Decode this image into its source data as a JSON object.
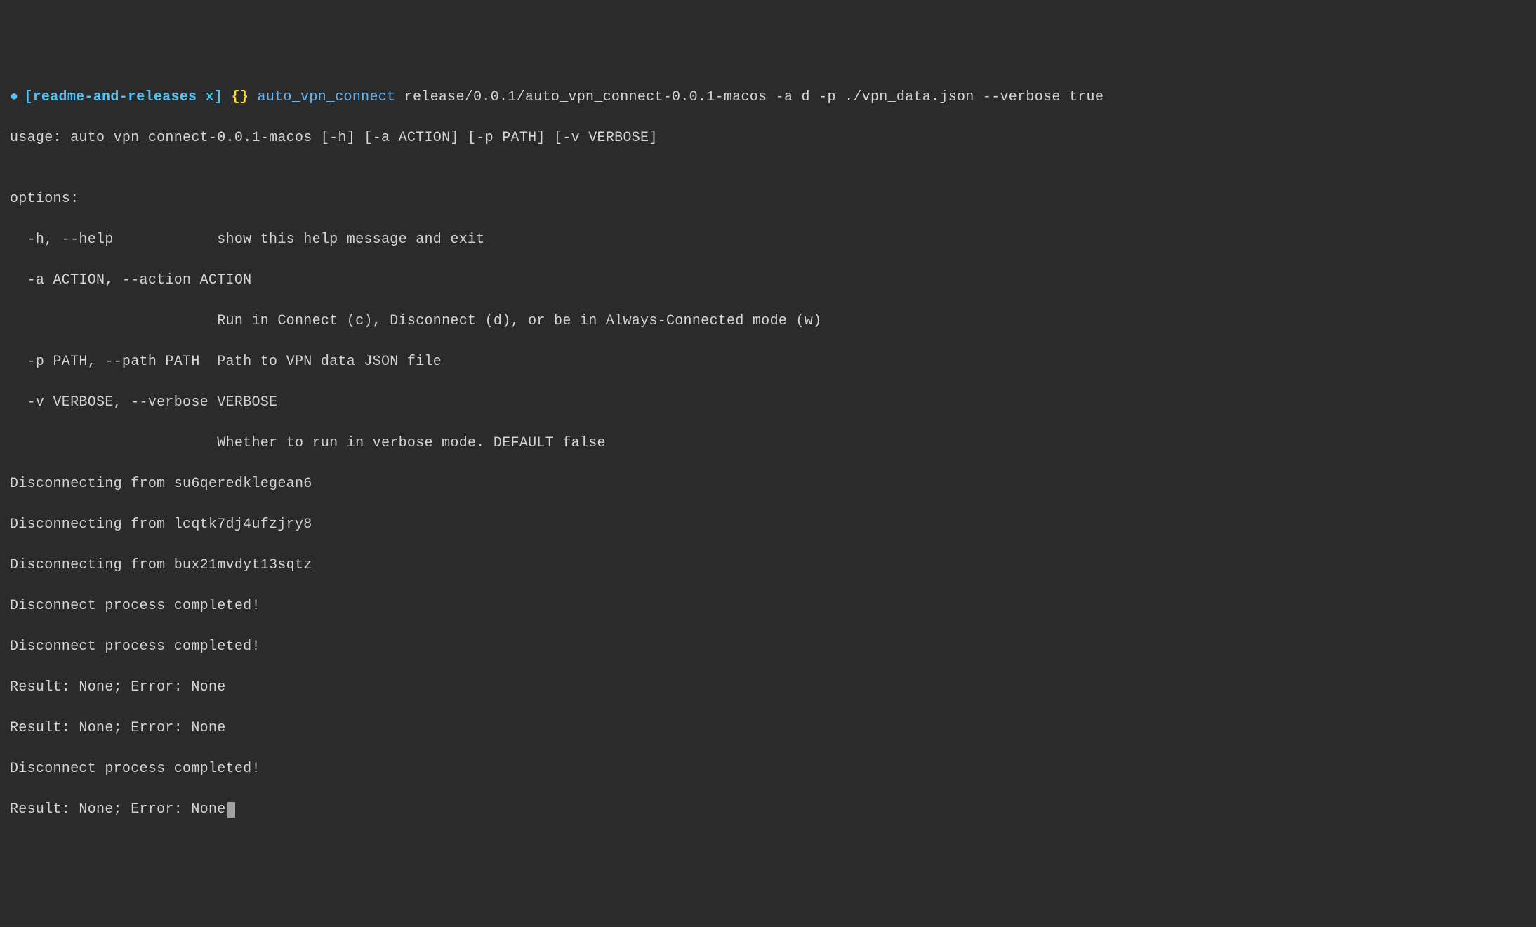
{
  "prompt": {
    "bullet": "●",
    "open_bracket": "[",
    "branch": "readme-and-releases x",
    "close_bracket": "]",
    "curly": "{}",
    "command": "auto_vpn_connect",
    "args": "release/0.0.1/auto_vpn_connect-0.0.1-macos -a d -p ./vpn_data.json --verbose true"
  },
  "output_lines": [
    "usage: auto_vpn_connect-0.0.1-macos [-h] [-a ACTION] [-p PATH] [-v VERBOSE]",
    "",
    "options:",
    "  -h, --help            show this help message and exit",
    "  -a ACTION, --action ACTION",
    "                        Run in Connect (c), Disconnect (d), or be in Always-Connected mode (w)",
    "  -p PATH, --path PATH  Path to VPN data JSON file",
    "  -v VERBOSE, --verbose VERBOSE",
    "                        Whether to run in verbose mode. DEFAULT false",
    "Disconnecting from su6qeredklegean6",
    "Disconnecting from lcqtk7dj4ufzjry8",
    "Disconnecting from bux21mvdyt13sqtz",
    "Disconnect process completed!",
    "Disconnect process completed!",
    "Result: None; Error: None",
    "Result: None; Error: None",
    "Disconnect process completed!",
    "Result: None; Error: None"
  ]
}
